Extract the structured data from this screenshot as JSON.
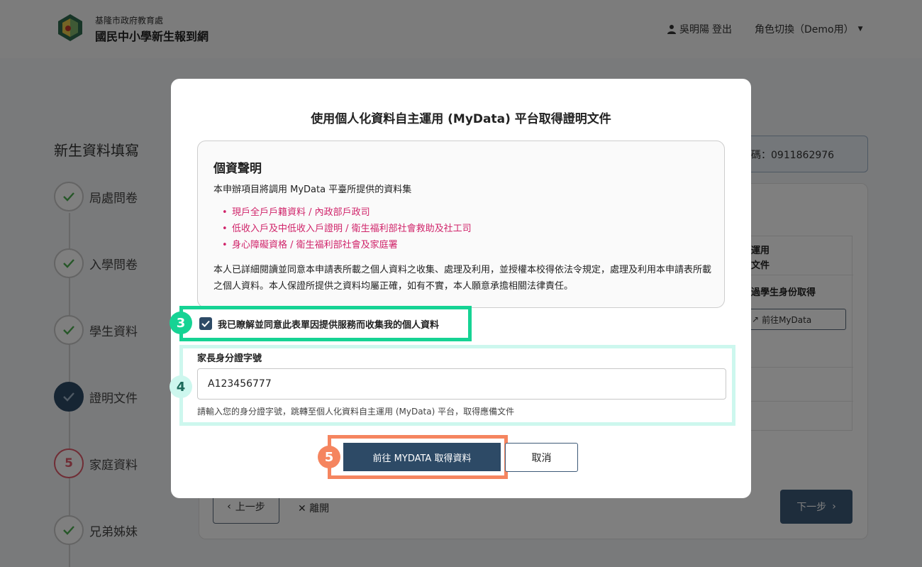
{
  "header": {
    "org_name": "基隆市政府教育處",
    "site_title": "國民中小學新生報到網",
    "user_name": "吳明陽",
    "logout_label": "登出",
    "role_switch_label": "角色切換（Demo用）"
  },
  "sidebar": {
    "title": "新生資料填寫",
    "steps": [
      {
        "label": "局處問卷",
        "state": "done"
      },
      {
        "label": "入學問卷",
        "state": "done"
      },
      {
        "label": "學生資料",
        "state": "done"
      },
      {
        "label": "證明文件",
        "state": "current"
      },
      {
        "label": "家庭資料",
        "state": "pending",
        "number": "5"
      },
      {
        "label": "兄弟姊妹",
        "state": "done"
      }
    ]
  },
  "main": {
    "phone_text": "碼：0911862976",
    "table": {
      "row1": "運用\n文件",
      "row2": "過學生身份取得",
      "mydata_button": "前往MyData"
    },
    "prev_button": "上一步",
    "leave_button": "離開",
    "next_button": "下一步"
  },
  "modal": {
    "title": "使用個人化資料自主運用 (MyData) 平台取得證明文件",
    "notice": {
      "title": "個資聲明",
      "intro": "本申辦項目將調用 MyData 平臺所提供的資料集",
      "datasets": [
        "現戶全戶戶籍資料 / 內政部戶政司",
        "低收入戶及中低收入戶證明 / 衛生福利部社會救助及社工司",
        "身心障礙資格 / 衛生福利部社會及家庭署"
      ],
      "body": "本人已詳細閱讀並同意本申請表所載之個人資料之收集、處理及利用，並授權本校得依法令規定，處理及利用本申請表所載之個人資料。本人保證所提供之資料均屬正確，如有不實，本人願意承擔相關法律責任。"
    },
    "consent_label": "我已瞭解並同意此表單因提供服務而收集我的個人資料",
    "consent_checked": true,
    "id_label": "家長身分證字號",
    "id_value": "A123456777",
    "id_hint": "請輸入您的身分證字號，跳轉至個人化資料自主運用 (MyData) 平台，取得應備文件",
    "go_button": "前往 MYDATA 取得資料",
    "cancel_button": "取消"
  },
  "annotations": {
    "consent_badge": "3",
    "id_badge": "4",
    "go_badge": "5"
  },
  "colors": {
    "primary": "#2d4a66",
    "badge_green": "#16d394",
    "badge_mint": "#cdf7ee",
    "badge_orange": "#f5855f",
    "dataset_red": "#d0246a"
  }
}
